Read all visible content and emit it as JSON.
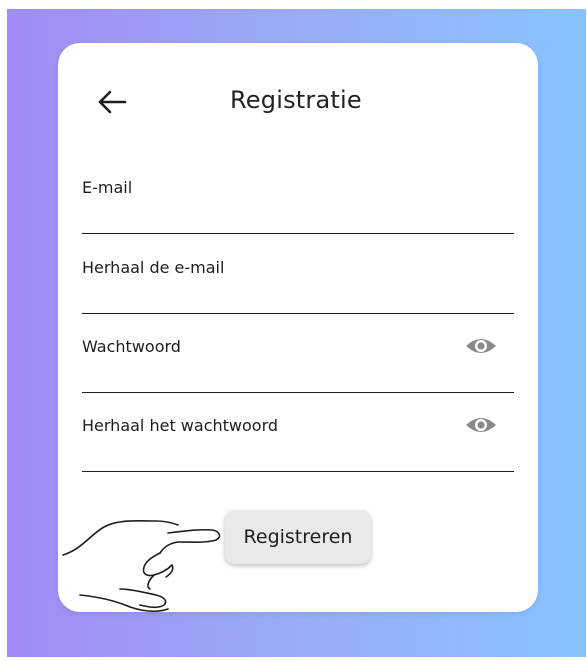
{
  "header": {
    "back_icon": "arrow-left-icon",
    "title": "Registratie"
  },
  "form": {
    "fields": [
      {
        "label": "E-mail",
        "has_visibility_toggle": false
      },
      {
        "label": "Herhaal de e-mail",
        "has_visibility_toggle": false
      },
      {
        "label": "Wachtwoord",
        "has_visibility_toggle": true,
        "toggle_icon": "eye-icon"
      },
      {
        "label": "Herhaal het wachtwoord",
        "has_visibility_toggle": true,
        "toggle_icon": "eye-icon"
      }
    ],
    "submit_label": "Registreren"
  },
  "pointer": {
    "icon": "pointing-hand-icon"
  },
  "colors": {
    "background_gradient_start": "#a08bf4",
    "background_gradient_end": "#88c3ff",
    "card": "#ffffff",
    "button": "#e9e9e9",
    "text": "#1e1e1e",
    "eye_icon": "#8a8a8a"
  }
}
